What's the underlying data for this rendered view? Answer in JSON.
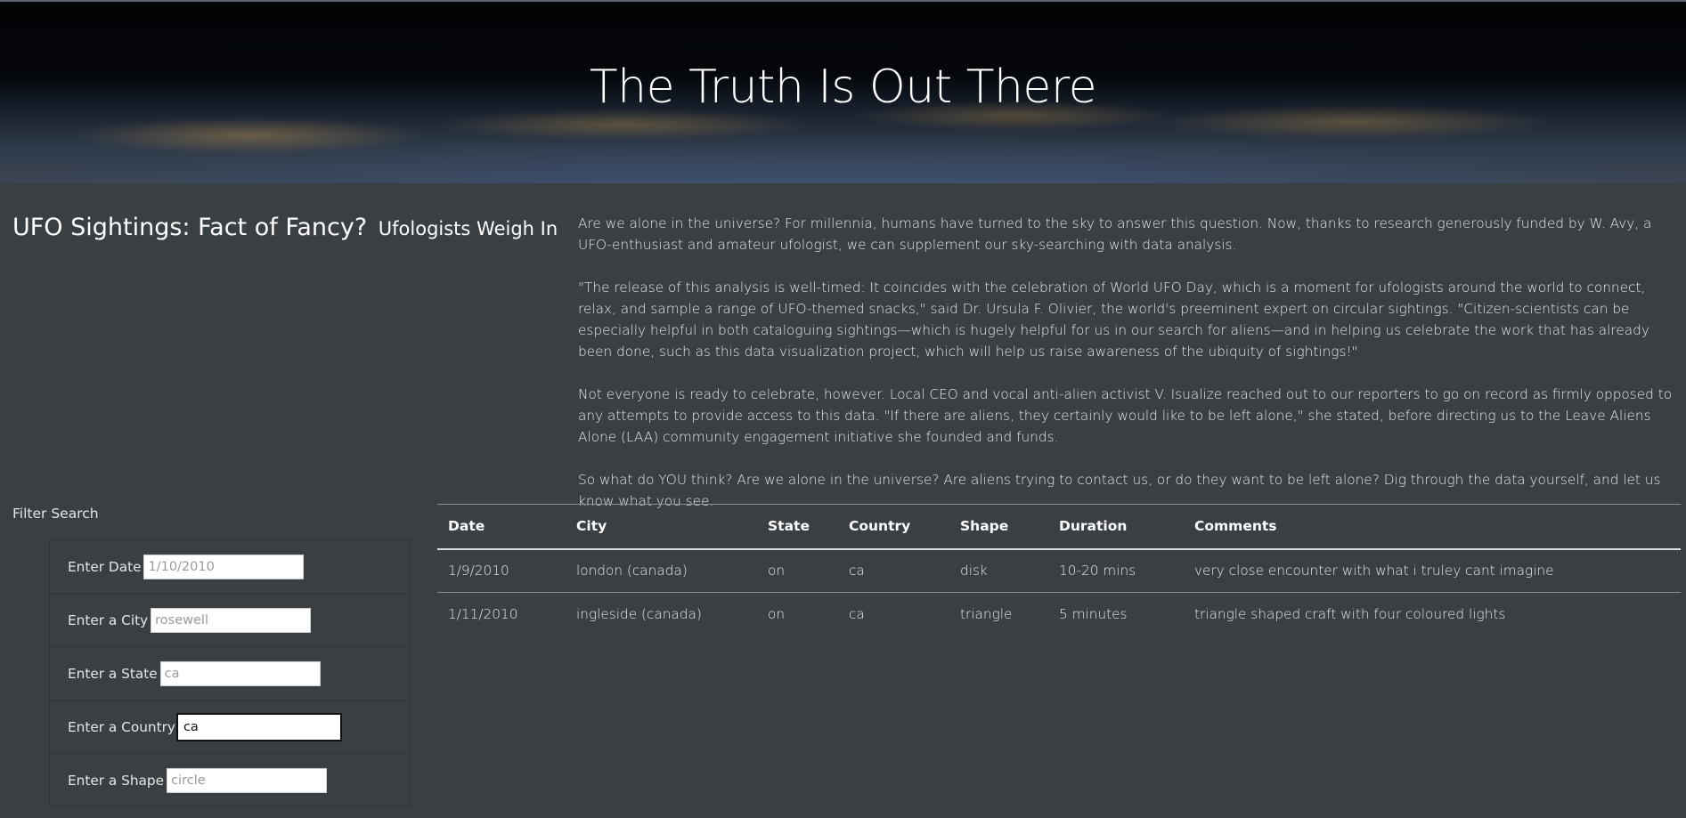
{
  "hero": {
    "title": "The Truth Is Out There"
  },
  "headline": {
    "main": "UFO Sightings: Fact of Fancy?",
    "sub": "Ufologists Weigh In"
  },
  "article": {
    "paragraphs": [
      "Are we alone in the universe? For millennia, humans have turned to the sky to answer this question. Now, thanks to research generously funded by W. Avy, a UFO-enthusiast and amateur ufologist, we can supplement our sky-searching with data analysis.",
      "\"The release of this analysis is well-timed: It coincides with the celebration of World UFO Day, which is a moment for ufologists around the world to connect, relax, and sample a range of UFO-themed snacks,\" said Dr. Ursula F. Olivier, the world's preeminent expert on circular sightings. \"Citizen-scientists can be especially helpful in both cataloguing sightings—which is hugely helpful for us in our search for aliens—and in helping us celebrate the work that has already been done, such as this data visualization project, which will help us raise awareness of the ubiquity of sightings!\"",
      "Not everyone is ready to celebrate, however. Local CEO and vocal anti-alien activist V. Isualize reached out to our reporters to go on record as firmly opposed to any attempts to provide access to this data. \"If there are aliens, they certainly would like to be left alone,\" she stated, before directing us to the Leave Aliens Alone (LAA) community engagement initiative she founded and funds.",
      "So what do YOU think? Are we alone in the universe? Are aliens trying to contact us, or do they want to be left alone? Dig through the data yourself, and let us know what you see."
    ]
  },
  "filters": {
    "heading": "Filter Search",
    "date": {
      "label": "Enter Date",
      "placeholder": "1/10/2010",
      "value": ""
    },
    "city": {
      "label": "Enter a City",
      "placeholder": "rosewell",
      "value": ""
    },
    "state": {
      "label": "Enter a State",
      "placeholder": "ca",
      "value": ""
    },
    "country": {
      "label": "Enter a Country",
      "placeholder": "",
      "value": "ca"
    },
    "shape": {
      "label": "Enter a Shape",
      "placeholder": "circle",
      "value": ""
    }
  },
  "table": {
    "headers": [
      "Date",
      "City",
      "State",
      "Country",
      "Shape",
      "Duration",
      "Comments"
    ],
    "rows": [
      [
        "1/9/2010",
        "london (canada)",
        "on",
        "ca",
        "disk",
        "10-20 mins",
        "very close encounter with what i truley cant imagine"
      ],
      [
        "1/11/2010",
        "ingleside (canada)",
        "on",
        "ca",
        "triangle",
        "5 minutes",
        "triangle shaped craft with four coloured lights"
      ]
    ]
  }
}
